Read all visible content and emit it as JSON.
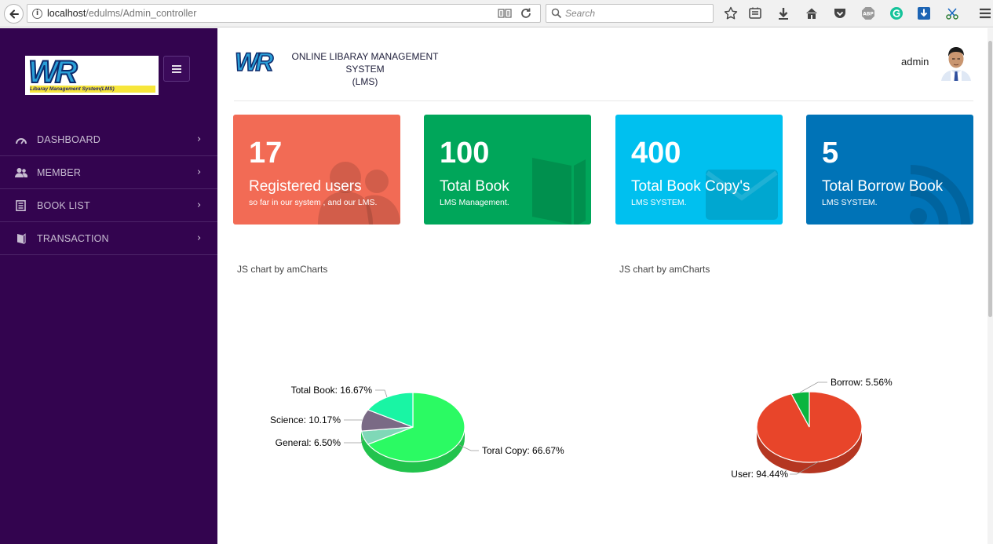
{
  "browser": {
    "url_host": "localhost",
    "url_path": "/edulms/Admin_controller",
    "search_placeholder": "Search"
  },
  "sidebar": {
    "logo_text": "WR",
    "logo_subtext": "Libaray Management System(LMS)",
    "items": [
      {
        "label": "DASHBOARD",
        "icon": "dashboard-gauge-icon"
      },
      {
        "label": "MEMBER",
        "icon": "users-icon"
      },
      {
        "label": "BOOK LIST",
        "icon": "list-icon"
      },
      {
        "label": "TRANSACTION",
        "icon": "book-icon"
      }
    ]
  },
  "header": {
    "title_line1": "ONLINE LIBARAY MANAGEMENT SYSTEM",
    "title_line2": "(LMS)",
    "user_name": "admin"
  },
  "cards": [
    {
      "value": "17",
      "title": "Registered users",
      "subtitle": "so far in our system , and our LMS.",
      "color": "#f26b55",
      "icon": "users-icon"
    },
    {
      "value": "100",
      "title": "Total Book",
      "subtitle": "LMS Management.",
      "color": "#00a65a",
      "icon": "book-icon"
    },
    {
      "value": "400",
      "title": "Total Book Copy's",
      "subtitle": "LMS SYSTEM.",
      "color": "#00c0ef",
      "icon": "envelope-icon"
    },
    {
      "value": "5",
      "title": "Total Borrow Book",
      "subtitle": "LMS SYSTEM.",
      "color": "#0073b7",
      "icon": "rss-icon"
    }
  ],
  "charts_credit": "JS chart by amCharts",
  "chart_data": [
    {
      "type": "pie",
      "slices": [
        {
          "label": "Toral Copy",
          "value": 66.67,
          "display": "Toral Copy: 66.67%",
          "color": "#2bfa63"
        },
        {
          "label": "General",
          "value": 6.5,
          "display": "General: 6.50%",
          "color": "#7fd8b7"
        },
        {
          "label": "Science",
          "value": 10.17,
          "display": "Science: 10.17%",
          "color": "#7a6a85"
        },
        {
          "label": "Total Book",
          "value": 16.67,
          "display": "Total Book: 16.67%",
          "color": "#19f5a4"
        }
      ]
    },
    {
      "type": "pie",
      "slices": [
        {
          "label": "User",
          "value": 94.44,
          "display": "User: 94.44%",
          "color": "#e8452a"
        },
        {
          "label": "Borrow",
          "value": 5.56,
          "display": "Borrow: 5.56%",
          "color": "#0bb53f"
        }
      ]
    }
  ]
}
